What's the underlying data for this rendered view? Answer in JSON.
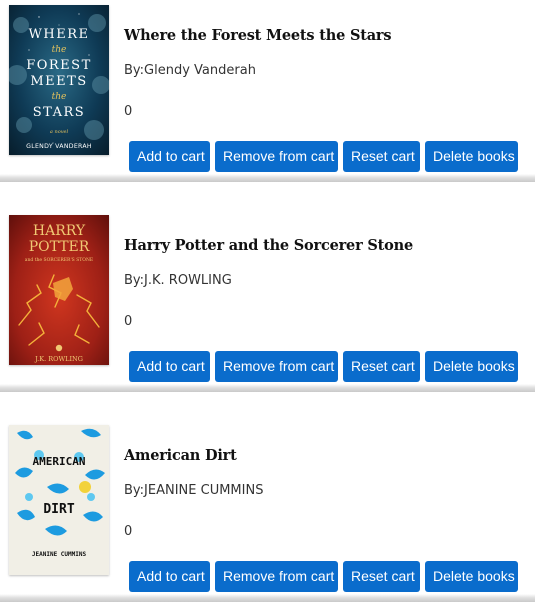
{
  "buttons": {
    "add": "Add to cart",
    "remove": "Remove from cart",
    "reset": "Reset cart",
    "delete": "Delete books"
  },
  "books": [
    {
      "title": "Where the Forest Meets the Stars",
      "author": "By:Glendy Vanderah",
      "count": "0",
      "cover": {
        "lines": [
          "WHERE",
          "the",
          "FOREST",
          "MEETS",
          "the",
          "STARS"
        ],
        "tagline": "a novel",
        "author": "GLENDY VANDERAH",
        "bg": "#0d3550"
      }
    },
    {
      "title": "Harry Potter and the Sorcerer Stone",
      "author": "By:J.K. ROWLING",
      "count": "0",
      "cover": {
        "lines": [
          "HARRY",
          "POTTER"
        ],
        "subtitle": "and the SORCERER'S STONE",
        "author": "J.K. ROWLING",
        "bg": "#a8231a"
      }
    },
    {
      "title": "American Dirt",
      "author": "By:JEANINE CUMMINS",
      "count": "0",
      "cover": {
        "lines": [
          "AMERICAN",
          "DIRT"
        ],
        "author": "JEANINE CUMMINS",
        "bg": "#f1efe6"
      }
    }
  ]
}
